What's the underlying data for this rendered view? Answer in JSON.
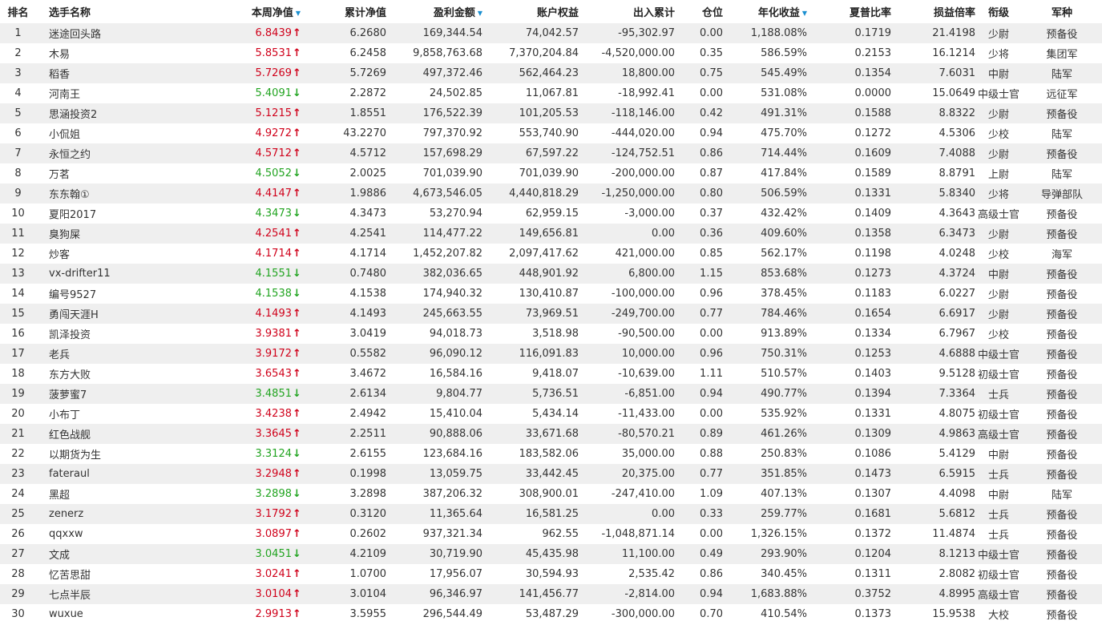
{
  "headers": [
    "排名",
    "选手名称",
    "本周净值",
    "累计净值",
    "盈利金额",
    "账户权益",
    "出入累计",
    "仓位",
    "年化收益",
    "夏普比率",
    "损益倍率",
    "衔级",
    "军种"
  ],
  "sort_marker": "▼",
  "colors": {
    "up": "#d0021b",
    "down": "#22a421",
    "sort": "#1a8fd0"
  },
  "rows": [
    {
      "rank": "1",
      "name": "迷途回头路",
      "weekly": "6.8439",
      "dir": "up",
      "cum": "6.2680",
      "profit": "169,344.54",
      "equity": "74,042.57",
      "flow": "-95,302.97",
      "pos": "0.00",
      "annual": "1,188.08%",
      "sharpe": "0.1719",
      "pl": "21.4198",
      "rankTitle": "少尉",
      "branch": "预备役"
    },
    {
      "rank": "2",
      "name": "木易",
      "weekly": "5.8531",
      "dir": "up",
      "cum": "6.2458",
      "profit": "9,858,763.68",
      "equity": "7,370,204.84",
      "flow": "-4,520,000.00",
      "pos": "0.35",
      "annual": "586.59%",
      "sharpe": "0.2153",
      "pl": "16.1214",
      "rankTitle": "少将",
      "branch": "集团军"
    },
    {
      "rank": "3",
      "name": "稻香",
      "weekly": "5.7269",
      "dir": "up",
      "cum": "5.7269",
      "profit": "497,372.46",
      "equity": "562,464.23",
      "flow": "18,800.00",
      "pos": "0.75",
      "annual": "545.49%",
      "sharpe": "0.1354",
      "pl": "7.6031",
      "rankTitle": "中尉",
      "branch": "陆军"
    },
    {
      "rank": "4",
      "name": "河南王",
      "weekly": "5.4091",
      "dir": "down",
      "cum": "2.2872",
      "profit": "24,502.85",
      "equity": "11,067.81",
      "flow": "-18,992.41",
      "pos": "0.00",
      "annual": "531.08%",
      "sharpe": "0.0000",
      "pl": "15.0649",
      "rankTitle": "中级士官",
      "branch": "远征军"
    },
    {
      "rank": "5",
      "name": "思涵投资2",
      "weekly": "5.1215",
      "dir": "up",
      "cum": "1.8551",
      "profit": "176,522.39",
      "equity": "101,205.53",
      "flow": "-118,146.00",
      "pos": "0.42",
      "annual": "491.31%",
      "sharpe": "0.1588",
      "pl": "8.8322",
      "rankTitle": "少尉",
      "branch": "预备役"
    },
    {
      "rank": "6",
      "name": "小侃姐",
      "weekly": "4.9272",
      "dir": "up",
      "cum": "43.2270",
      "profit": "797,370.92",
      "equity": "553,740.90",
      "flow": "-444,020.00",
      "pos": "0.94",
      "annual": "475.70%",
      "sharpe": "0.1272",
      "pl": "4.5306",
      "rankTitle": "少校",
      "branch": "陆军"
    },
    {
      "rank": "7",
      "name": "永恒之约",
      "weekly": "4.5712",
      "dir": "up",
      "cum": "4.5712",
      "profit": "157,698.29",
      "equity": "67,597.22",
      "flow": "-124,752.51",
      "pos": "0.86",
      "annual": "714.44%",
      "sharpe": "0.1609",
      "pl": "7.4088",
      "rankTitle": "少尉",
      "branch": "预备役"
    },
    {
      "rank": "8",
      "name": "万茗",
      "weekly": "4.5052",
      "dir": "down",
      "cum": "2.0025",
      "profit": "701,039.90",
      "equity": "701,039.90",
      "flow": "-200,000.00",
      "pos": "0.87",
      "annual": "417.84%",
      "sharpe": "0.1589",
      "pl": "8.8791",
      "rankTitle": "上尉",
      "branch": "陆军"
    },
    {
      "rank": "9",
      "name": "东东翰①",
      "weekly": "4.4147",
      "dir": "up",
      "cum": "1.9886",
      "profit": "4,673,546.05",
      "equity": "4,440,818.29",
      "flow": "-1,250,000.00",
      "pos": "0.80",
      "annual": "506.59%",
      "sharpe": "0.1331",
      "pl": "5.8340",
      "rankTitle": "少将",
      "branch": "导弹部队"
    },
    {
      "rank": "10",
      "name": "夏阳2017",
      "weekly": "4.3473",
      "dir": "down",
      "cum": "4.3473",
      "profit": "53,270.94",
      "equity": "62,959.15",
      "flow": "-3,000.00",
      "pos": "0.37",
      "annual": "432.42%",
      "sharpe": "0.1409",
      "pl": "4.3643",
      "rankTitle": "高级士官",
      "branch": "预备役"
    },
    {
      "rank": "11",
      "name": "臭狗屎",
      "weekly": "4.2541",
      "dir": "up",
      "cum": "4.2541",
      "profit": "114,477.22",
      "equity": "149,656.81",
      "flow": "0.00",
      "pos": "0.36",
      "annual": "409.60%",
      "sharpe": "0.1358",
      "pl": "6.3473",
      "rankTitle": "少尉",
      "branch": "预备役"
    },
    {
      "rank": "12",
      "name": "炒客",
      "weekly": "4.1714",
      "dir": "up",
      "cum": "4.1714",
      "profit": "1,452,207.82",
      "equity": "2,097,417.62",
      "flow": "421,000.00",
      "pos": "0.85",
      "annual": "562.17%",
      "sharpe": "0.1198",
      "pl": "4.0248",
      "rankTitle": "少校",
      "branch": "海军"
    },
    {
      "rank": "13",
      "name": "vx-drifter11",
      "weekly": "4.1551",
      "dir": "down",
      "cum": "0.7480",
      "profit": "382,036.65",
      "equity": "448,901.92",
      "flow": "6,800.00",
      "pos": "1.15",
      "annual": "853.68%",
      "sharpe": "0.1273",
      "pl": "4.3724",
      "rankTitle": "中尉",
      "branch": "预备役"
    },
    {
      "rank": "14",
      "name": "编号9527",
      "weekly": "4.1538",
      "dir": "down",
      "cum": "4.1538",
      "profit": "174,940.32",
      "equity": "130,410.87",
      "flow": "-100,000.00",
      "pos": "0.96",
      "annual": "378.45%",
      "sharpe": "0.1183",
      "pl": "6.0227",
      "rankTitle": "少尉",
      "branch": "预备役"
    },
    {
      "rank": "15",
      "name": "勇闯天涯H",
      "weekly": "4.1493",
      "dir": "up",
      "cum": "4.1493",
      "profit": "245,663.55",
      "equity": "73,969.51",
      "flow": "-249,700.00",
      "pos": "0.77",
      "annual": "784.46%",
      "sharpe": "0.1654",
      "pl": "6.6917",
      "rankTitle": "少尉",
      "branch": "预备役"
    },
    {
      "rank": "16",
      "name": "凯泽投资",
      "weekly": "3.9381",
      "dir": "up",
      "cum": "3.0419",
      "profit": "94,018.73",
      "equity": "3,518.98",
      "flow": "-90,500.00",
      "pos": "0.00",
      "annual": "913.89%",
      "sharpe": "0.1334",
      "pl": "6.7967",
      "rankTitle": "少校",
      "branch": "预备役"
    },
    {
      "rank": "17",
      "name": "老兵",
      "weekly": "3.9172",
      "dir": "up",
      "cum": "0.5582",
      "profit": "96,090.12",
      "equity": "116,091.83",
      "flow": "10,000.00",
      "pos": "0.96",
      "annual": "750.31%",
      "sharpe": "0.1253",
      "pl": "4.6888",
      "rankTitle": "中级士官",
      "branch": "预备役"
    },
    {
      "rank": "18",
      "name": "东方大败",
      "weekly": "3.6543",
      "dir": "up",
      "cum": "3.4672",
      "profit": "16,584.16",
      "equity": "9,418.07",
      "flow": "-10,639.00",
      "pos": "1.11",
      "annual": "510.57%",
      "sharpe": "0.1403",
      "pl": "9.5128",
      "rankTitle": "初级士官",
      "branch": "预备役"
    },
    {
      "rank": "19",
      "name": "菠萝蜜7",
      "weekly": "3.4851",
      "dir": "down",
      "cum": "2.6134",
      "profit": "9,804.77",
      "equity": "5,736.51",
      "flow": "-6,851.00",
      "pos": "0.94",
      "annual": "490.77%",
      "sharpe": "0.1394",
      "pl": "7.3364",
      "rankTitle": "士兵",
      "branch": "预备役"
    },
    {
      "rank": "20",
      "name": "小布丁",
      "weekly": "3.4238",
      "dir": "up",
      "cum": "2.4942",
      "profit": "15,410.04",
      "equity": "5,434.14",
      "flow": "-11,433.00",
      "pos": "0.00",
      "annual": "535.92%",
      "sharpe": "0.1331",
      "pl": "4.8075",
      "rankTitle": "初级士官",
      "branch": "预备役"
    },
    {
      "rank": "21",
      "name": "红色战舰",
      "weekly": "3.3645",
      "dir": "up",
      "cum": "2.2511",
      "profit": "90,888.06",
      "equity": "33,671.68",
      "flow": "-80,570.21",
      "pos": "0.89",
      "annual": "461.26%",
      "sharpe": "0.1309",
      "pl": "4.9863",
      "rankTitle": "高级士官",
      "branch": "预备役"
    },
    {
      "rank": "22",
      "name": "以期货为生",
      "weekly": "3.3124",
      "dir": "down",
      "cum": "2.6155",
      "profit": "123,684.16",
      "equity": "183,582.06",
      "flow": "35,000.00",
      "pos": "0.88",
      "annual": "250.83%",
      "sharpe": "0.1086",
      "pl": "5.4129",
      "rankTitle": "中尉",
      "branch": "预备役"
    },
    {
      "rank": "23",
      "name": "fateraul",
      "weekly": "3.2948",
      "dir": "up",
      "cum": "0.1998",
      "profit": "13,059.75",
      "equity": "33,442.45",
      "flow": "20,375.00",
      "pos": "0.77",
      "annual": "351.85%",
      "sharpe": "0.1473",
      "pl": "6.5915",
      "rankTitle": "士兵",
      "branch": "预备役"
    },
    {
      "rank": "24",
      "name": "黑超",
      "weekly": "3.2898",
      "dir": "down",
      "cum": "3.2898",
      "profit": "387,206.32",
      "equity": "308,900.01",
      "flow": "-247,410.00",
      "pos": "1.09",
      "annual": "407.13%",
      "sharpe": "0.1307",
      "pl": "4.4098",
      "rankTitle": "中尉",
      "branch": "陆军"
    },
    {
      "rank": "25",
      "name": "zenerz",
      "weekly": "3.1792",
      "dir": "up",
      "cum": "0.3120",
      "profit": "11,365.64",
      "equity": "16,581.25",
      "flow": "0.00",
      "pos": "0.33",
      "annual": "259.77%",
      "sharpe": "0.1681",
      "pl": "5.6812",
      "rankTitle": "士兵",
      "branch": "预备役"
    },
    {
      "rank": "26",
      "name": "qqxxw",
      "weekly": "3.0897",
      "dir": "up",
      "cum": "0.2602",
      "profit": "937,321.34",
      "equity": "962.55",
      "flow": "-1,048,871.14",
      "pos": "0.00",
      "annual": "1,326.15%",
      "sharpe": "0.1372",
      "pl": "11.4874",
      "rankTitle": "士兵",
      "branch": "预备役"
    },
    {
      "rank": "27",
      "name": "文成",
      "weekly": "3.0451",
      "dir": "down",
      "cum": "4.2109",
      "profit": "30,719.90",
      "equity": "45,435.98",
      "flow": "11,100.00",
      "pos": "0.49",
      "annual": "293.90%",
      "sharpe": "0.1204",
      "pl": "8.1213",
      "rankTitle": "中级士官",
      "branch": "预备役"
    },
    {
      "rank": "28",
      "name": "忆苦思甜",
      "weekly": "3.0241",
      "dir": "up",
      "cum": "1.0700",
      "profit": "17,956.07",
      "equity": "30,594.93",
      "flow": "2,535.42",
      "pos": "0.86",
      "annual": "340.45%",
      "sharpe": "0.1311",
      "pl": "2.8082",
      "rankTitle": "初级士官",
      "branch": "预备役"
    },
    {
      "rank": "29",
      "name": "七点半辰",
      "weekly": "3.0104",
      "dir": "up",
      "cum": "3.0104",
      "profit": "96,346.97",
      "equity": "141,456.77",
      "flow": "-2,814.00",
      "pos": "0.94",
      "annual": "1,683.88%",
      "sharpe": "0.3752",
      "pl": "4.8995",
      "rankTitle": "高级士官",
      "branch": "预备役"
    },
    {
      "rank": "30",
      "name": "wuxue",
      "weekly": "2.9913",
      "dir": "up",
      "cum": "3.5955",
      "profit": "296,544.49",
      "equity": "53,487.29",
      "flow": "-300,000.00",
      "pos": "0.70",
      "annual": "410.54%",
      "sharpe": "0.1373",
      "pl": "15.9538",
      "rankTitle": "大校",
      "branch": "预备役"
    }
  ]
}
